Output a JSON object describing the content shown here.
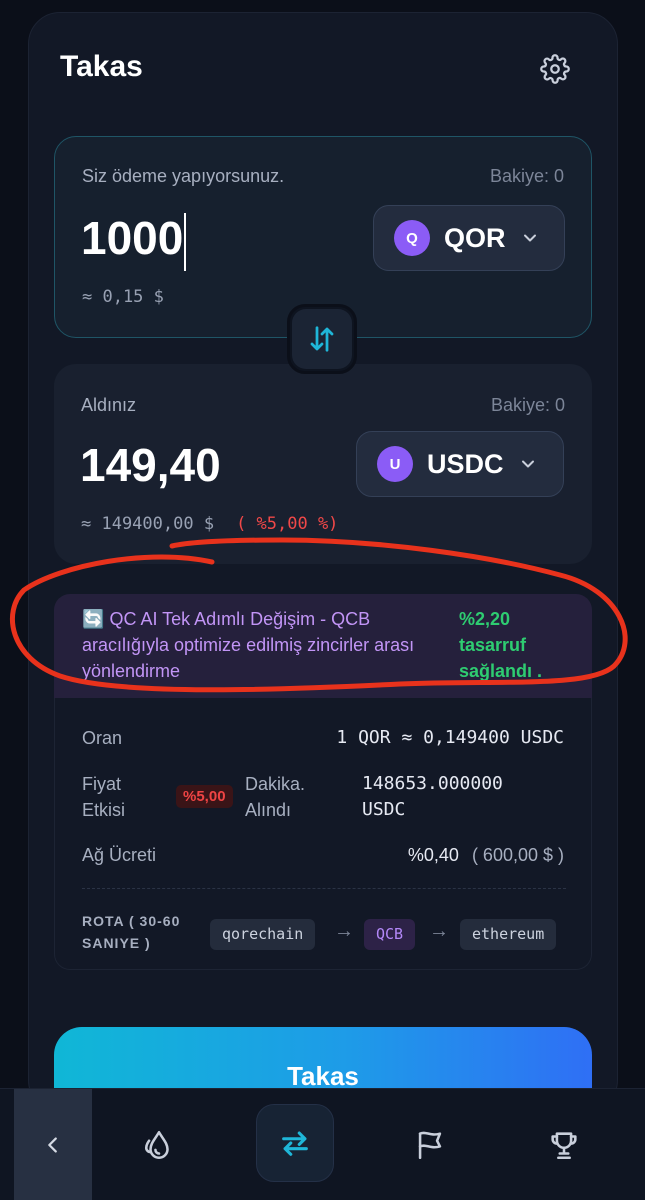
{
  "header": {
    "title": "Takas",
    "settings_icon": "gear-icon"
  },
  "pay": {
    "label": "Siz ödeme yapıyorsunuz.",
    "balance": "Bakiye: 0",
    "amount": "1000",
    "usd_value": "≈ 0,15 $",
    "token": {
      "icon_letter": "Q",
      "symbol": "QOR",
      "icon_color": "#8b5cf6"
    }
  },
  "switch": {
    "icon": "swap-vertical-icon"
  },
  "receive": {
    "label": "Aldınız",
    "balance": "Bakiye: 0",
    "amount": "149,40",
    "usd_value": "≈ 149400,00 $",
    "impact": "( %5,00 %)",
    "token": {
      "icon_letter": "U",
      "symbol": "USDC",
      "icon_color": "#8b5cf6"
    }
  },
  "ai_route": {
    "emoji": "🔄",
    "text": "QC AI Tek Adımlı Değişim - QCB aracılığıyla optimize edilmiş zincirler arası yönlendirme",
    "saving_value": "%2,20",
    "saving_text": "tasarruf sağlandı ."
  },
  "details": {
    "rate_label": "Oran",
    "rate_value": "1 QOR ≈ 0,149400 USDC",
    "price_impact_label_1": "Fiyat",
    "price_impact_label_2": "Etkisi",
    "price_impact_badge": "%5,00",
    "min_received_label_1": "Dakika.",
    "min_received_label_2": "Alındı",
    "min_received_value_1": "148653.000000",
    "min_received_value_2": "USDC",
    "network_fee_label": "Ağ Ücreti",
    "network_fee_percent": "%0,40",
    "network_fee_amount": "( 600,00 $ )",
    "route_label_1": "ROTA ( 30-60",
    "route_label_2": "SANIYE )",
    "route": [
      "qorechain",
      "QCB",
      "ethereum"
    ],
    "route_arrow": "→"
  },
  "cta": {
    "label": "Takas"
  },
  "nav": {
    "items": [
      "back-icon",
      "drop-icon",
      "swap-icon",
      "flag-icon",
      "trophy-icon"
    ],
    "active": "swap-icon"
  },
  "colors": {
    "accent_cyan": "#22b8d6",
    "accent_purple": "#8b5cf6",
    "danger": "#ef4444",
    "success": "#2ecc71",
    "annotation": "#e8321c"
  }
}
